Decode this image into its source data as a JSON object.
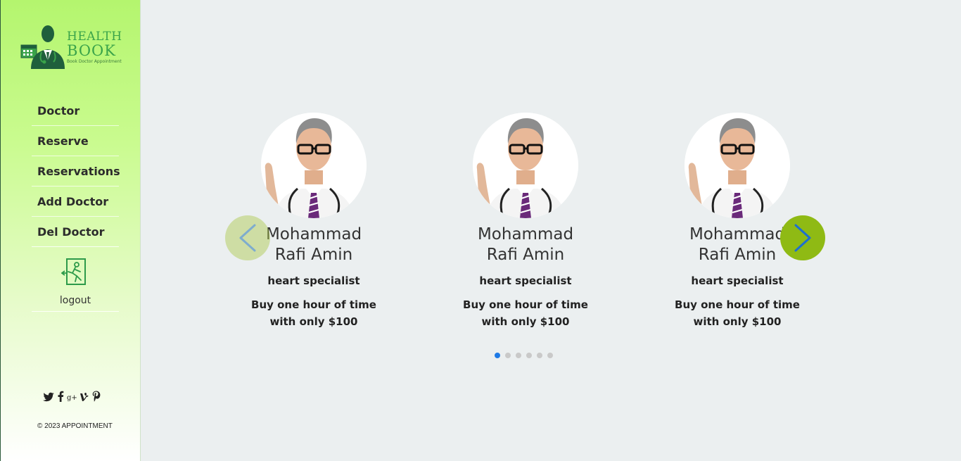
{
  "brand": {
    "line1": "HEALTH",
    "line2": "BOOK",
    "tagline": "Book Doctor Appointment"
  },
  "nav": {
    "items": [
      {
        "label": "Doctor"
      },
      {
        "label": "Reserve"
      },
      {
        "label": "Reservations"
      },
      {
        "label": "Add Doctor"
      },
      {
        "label": "Del Doctor"
      }
    ],
    "logout_label": "logout"
  },
  "social": {
    "icons": [
      "twitter-icon",
      "facebook-icon",
      "google-plus-icon",
      "vine-icon",
      "pinterest-icon"
    ]
  },
  "footer": {
    "copyright": "© 2023 APPOINTMENT"
  },
  "carousel": {
    "cards": [
      {
        "name": "Mohammad Rafi Amin",
        "specialty": "heart specialist",
        "description": "Buy one hour of time with only $100"
      },
      {
        "name": "Mohammad Rafi Amin",
        "specialty": "heart specialist",
        "description": "Buy one hour of time with only $100"
      },
      {
        "name": "Mohammad Rafi Amin",
        "specialty": "heart specialist",
        "description": "Buy one hour of time with only $100"
      }
    ],
    "page_count": 6,
    "active_page": 1
  },
  "colors": {
    "accent_green": "#8fba14",
    "active_dot": "#1e7ae6",
    "sidebar_top": "#b4f56e",
    "background": "#ebeff0"
  }
}
